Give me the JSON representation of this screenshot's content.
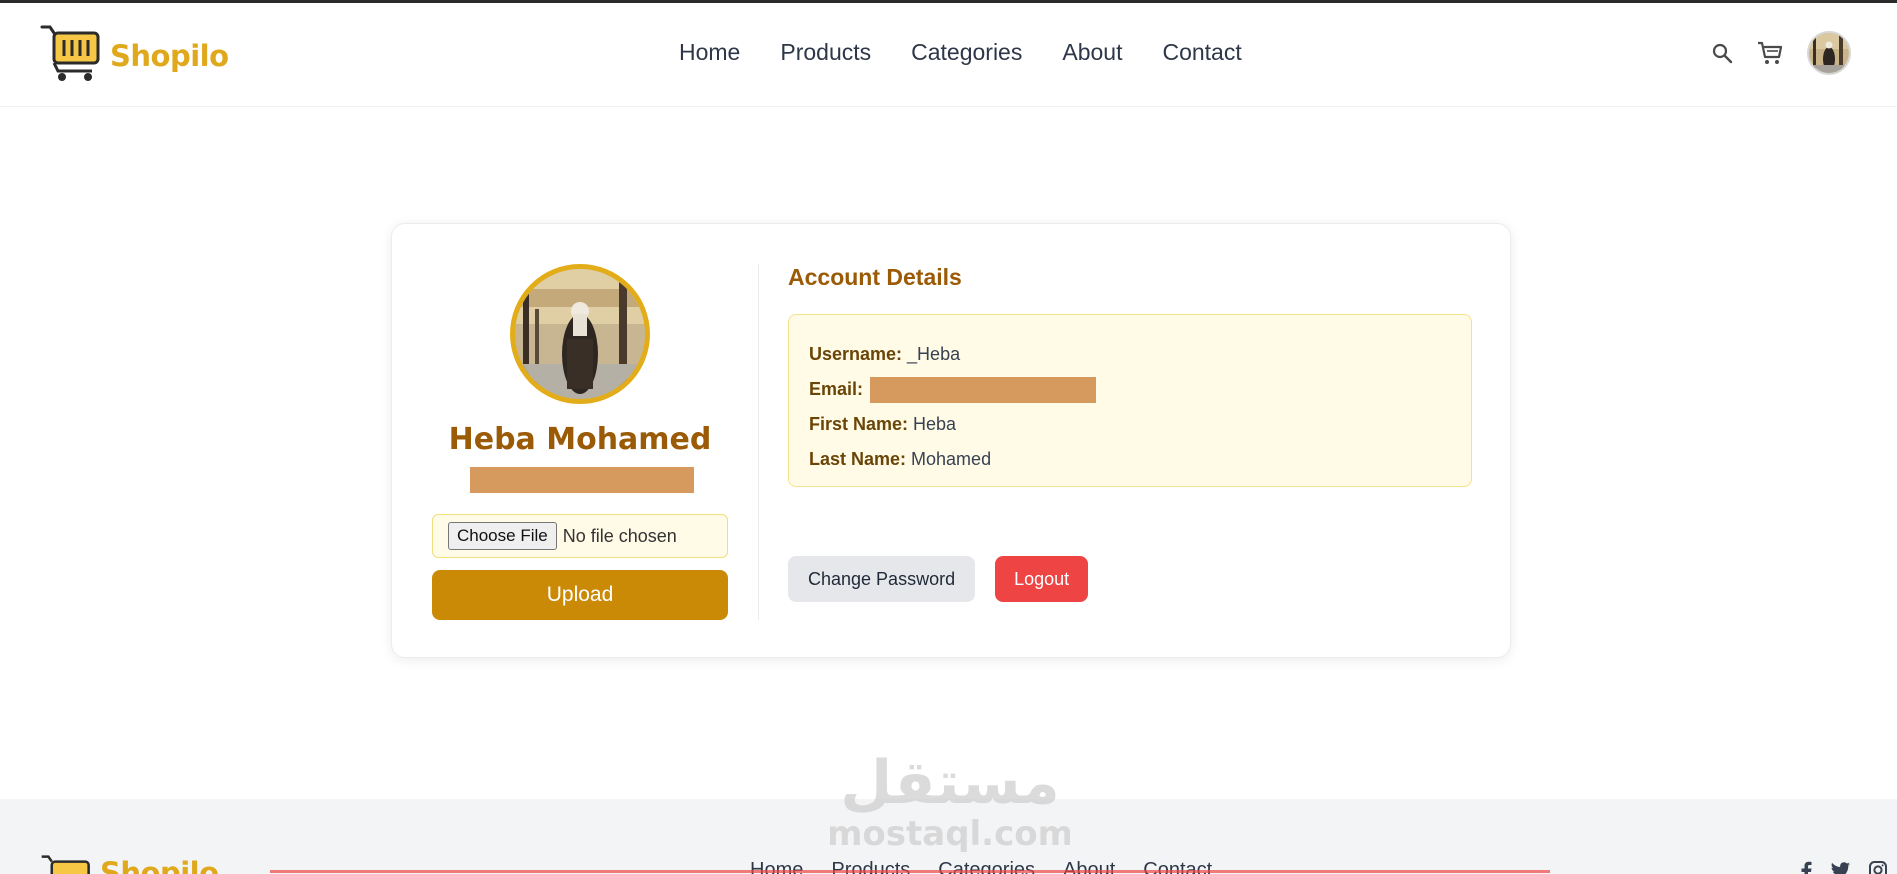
{
  "brand": {
    "name": "Shopilo",
    "accent": "#e0a81c"
  },
  "nav": {
    "items": [
      "Home",
      "Products",
      "Categories",
      "About",
      "Contact"
    ],
    "icons": [
      "search-icon",
      "cart-icon",
      "avatar"
    ]
  },
  "profile": {
    "name": "Heba Mohamed",
    "file_button": "Choose File",
    "file_status": "No file chosen",
    "upload_label": "Upload"
  },
  "account": {
    "title": "Account Details",
    "username_label": "Username:",
    "username": "_Heba",
    "email_label": "Email:",
    "first_name_label": "First Name:",
    "first_name": "Heba",
    "last_name_label": "Last Name:",
    "last_name": "Mohamed",
    "change_password_label": "Change Password",
    "logout_label": "Logout"
  },
  "watermark": {
    "arabic": "مستقل",
    "latin": "mostaql.com"
  },
  "footer": {
    "brand": "Shopilo",
    "nav": [
      "Home",
      "Products",
      "Categories",
      "About",
      "Contact"
    ]
  },
  "colors": {
    "primary_button": "#cb8a05",
    "logout": "#ef4444",
    "heading": "#9a5a06",
    "details_bg": "#fffbe6"
  }
}
